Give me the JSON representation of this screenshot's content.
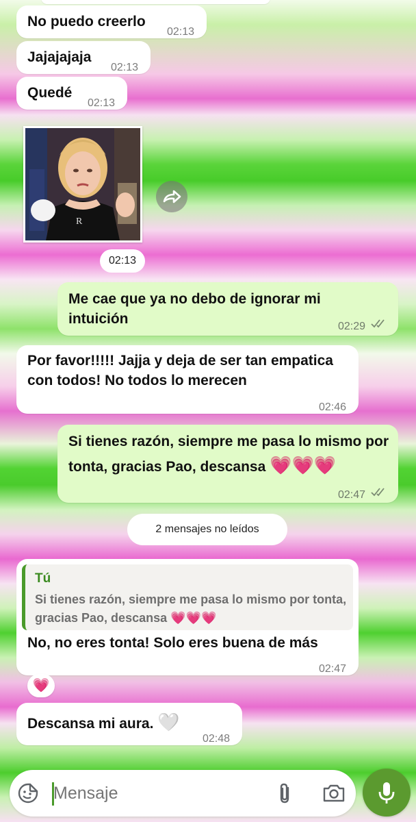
{
  "messages": [
    {
      "text": "No puedo creerlo",
      "time": "02:13"
    },
    {
      "text": "Jajajajaja",
      "time": "02:13"
    },
    {
      "text": "Quedé",
      "time": "02:13"
    },
    {
      "image_time": "02:13"
    },
    {
      "text": "Me cae que ya no debo de ignorar mi intuición",
      "time": "02:29"
    },
    {
      "text": "Por favor!!!!! Jajja y deja de ser tan empatica con todos! No todos lo merecen",
      "time": "02:46"
    },
    {
      "text": "Si tienes razón, siempre me pasa lo mismo por tonta, gracias Pao, descansa",
      "emoji": "💗💗💗",
      "time": "02:47"
    },
    {
      "reply_author": "Tú",
      "reply_text": "Si tienes razón, siempre me pasa lo mismo por tonta, gracias Pao, descansa",
      "reply_emoji": "💗💗💗",
      "text": "No, no eres tonta! Solo eres buena de más",
      "time": "02:47",
      "reaction": "💗"
    },
    {
      "text": "Descansa mi aura.",
      "emoji": "🤍",
      "time": "02:48"
    }
  ],
  "unread_label": "2 mensajes no leídos",
  "composer": {
    "placeholder": "Mensaje"
  },
  "colors": {
    "outgoing_bubble": "#e1fbc8",
    "incoming_bubble": "#ffffff",
    "mic_button": "#5b9a2f",
    "reply_bar": "#4a9a2a"
  },
  "icons": [
    "forward-icon",
    "double-check-icon",
    "sticker-icon",
    "attach-icon",
    "camera-icon",
    "mic-icon",
    "heart-icon"
  ]
}
